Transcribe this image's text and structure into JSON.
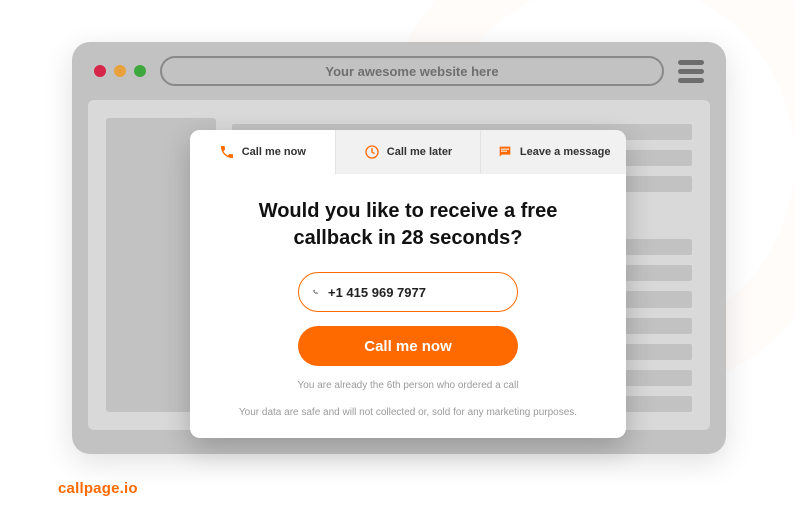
{
  "browser": {
    "address_placeholder": "Your awesome website here"
  },
  "popup": {
    "tabs": [
      {
        "label": "Call me now"
      },
      {
        "label": "Call me later"
      },
      {
        "label": "Leave a message"
      }
    ],
    "headline": "Would you like to receive a free callback in 28 seconds?",
    "phone_value": "+1 415 969 7977",
    "cta_label": "Call me now",
    "counter_note": "You are already the 6th person who ordered a call",
    "privacy_note": "Your data are safe and will not collected or, sold for any marketing purposes."
  },
  "brand": "callpage.io",
  "colors": {
    "accent": "#ff6a00"
  }
}
